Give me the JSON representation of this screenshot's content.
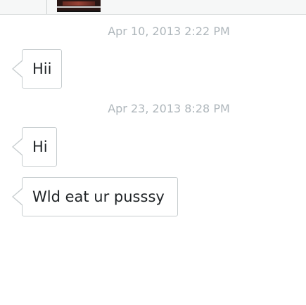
{
  "header": {
    "thumbnail_icon": "image-thumbnail"
  },
  "conversation": {
    "timestamps": [
      "Apr 10, 2013 2:22 PM",
      "Apr 23, 2013 8:28 PM"
    ],
    "messages": [
      "Hii",
      "Hi",
      "Wld eat ur pusssy"
    ]
  },
  "colors": {
    "timestamp_text": "#aeb6bb",
    "bubble_border": "#c7cdcf",
    "message_text": "#1f2326",
    "top_bar_background": "#f6f7f7"
  }
}
